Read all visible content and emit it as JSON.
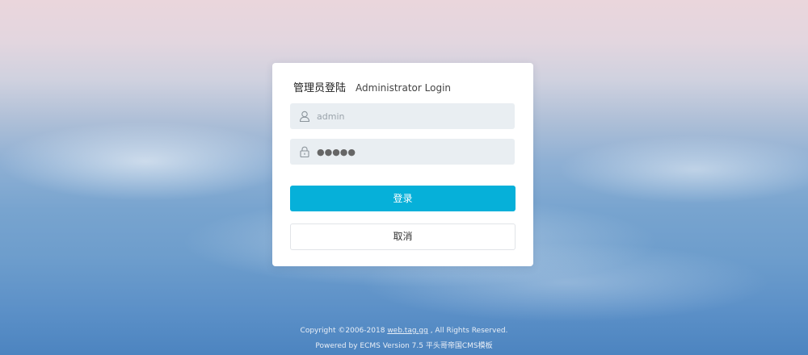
{
  "login": {
    "title_cn": "管理员登陆",
    "title_en": "Administrator Login",
    "username": {
      "placeholder": "admin",
      "icon": "user-icon"
    },
    "password": {
      "value": "●●●●●",
      "icon": "lock-icon"
    },
    "submit_label": "登录",
    "cancel_label": "取消"
  },
  "footer": {
    "copyright_prefix": "Copyright ©2006-2018",
    "link_text": "web.tag.gg",
    "copyright_suffix": ", All Rights Reserved.",
    "powered_by": "Powered by ECMS Version 7.5 平头哥帝国CMS模板"
  },
  "colors": {
    "primary_button": "#06b0d9",
    "input_bg": "#e9eef2"
  }
}
